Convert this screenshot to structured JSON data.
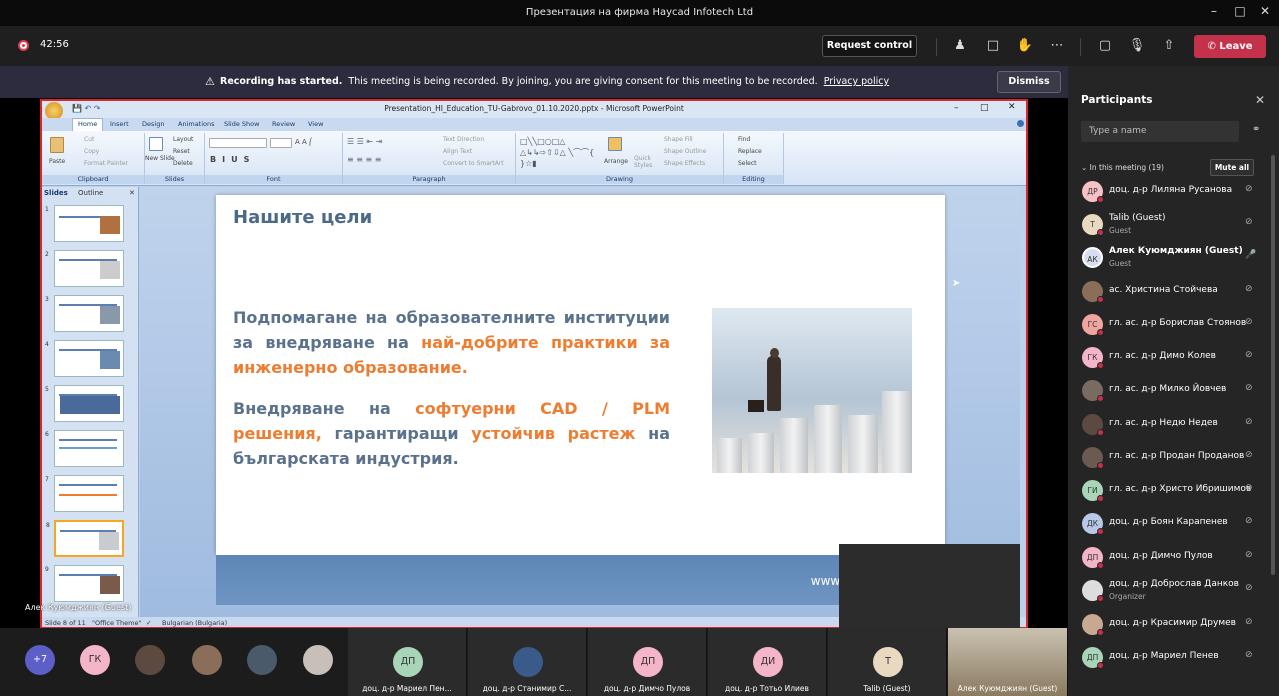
{
  "window": {
    "title": "Презентация на фирма Haycad Infotech Ltd"
  },
  "toolbar": {
    "timer": "42:56",
    "request_control": "Request control",
    "leave": "Leave"
  },
  "banner": {
    "bold": "Recording has started.",
    "text": "This meeting is being recorded. By joining, you are giving consent for this meeting to be recorded.",
    "link": "Privacy policy",
    "dismiss": "Dismiss"
  },
  "ppt": {
    "title": "Presentation_HI_Education_TU-Gabrovo_01.10.2020.pptx - Microsoft PowerPoint",
    "tabs": [
      "Home",
      "Insert",
      "Design",
      "Animations",
      "Slide Show",
      "Review",
      "View"
    ],
    "groups": [
      "Clipboard",
      "Slides",
      "Font",
      "Paragraph",
      "Drawing",
      "Editing"
    ],
    "clipboard": {
      "paste": "Paste",
      "cut": "Cut",
      "copy": "Copy",
      "painter": "Format Painter"
    },
    "slides_grp": {
      "new": "New Slide",
      "layout": "Layout",
      "reset": "Reset",
      "delete": "Delete"
    },
    "paragraph": {
      "dir": "Text Direction",
      "align": "Align Text",
      "smart": "Convert to SmartArt"
    },
    "drawing": {
      "arrange": "Arrange",
      "quick": "Quick Styles",
      "fill": "Shape Fill",
      "outline": "Shape Outline",
      "effects": "Shape Effects"
    },
    "editing": {
      "find": "Find",
      "replace": "Replace",
      "select": "Select"
    },
    "panel_tabs": {
      "slides": "Slides",
      "outline": "Outline"
    },
    "status": {
      "slide": "Slide 8 of 11",
      "theme": "\"Office Theme\"",
      "lang": "Bulgarian (Bulgaria)"
    },
    "slide": {
      "title": "Нашите цели",
      "p1_a": "Подпомагане на образователните институции за внедряване на ",
      "p1_b": "най-добрите практики за инженерно образование.",
      "p2_a": "Внедряване на ",
      "p2_b": "софтуерни CAD / PLM решения,",
      "p2_c": " гарантиращи ",
      "p2_d": "устойчив растеж",
      "p2_e": " на българската индустрия.",
      "footer": "www.hay"
    },
    "presenter_label": "Алек Куюмджиян (Guest)"
  },
  "participants": {
    "header": "Participants",
    "search_placeholder": "Type a name",
    "in_meeting": "In this meeting (19)",
    "mute_all": "Mute all",
    "list": [
      {
        "initials": "ДР",
        "name": "доц. д-р Лиляна Русанова",
        "sub": "",
        "color": "#f7c2c7"
      },
      {
        "initials": "T",
        "name": "Talib (Guest)",
        "sub": "Guest",
        "color": "#e9d9c0"
      },
      {
        "initials": "АК",
        "name": "Алек Куюмджиян (Guest)",
        "sub": "Guest",
        "color": "#d6def0"
      },
      {
        "initials": "",
        "name": "ас. Христина Стойчева",
        "sub": "",
        "color": "#8a6e5a"
      },
      {
        "initials": "ГС",
        "name": "гл. ас. д-р Борислав Стоянов",
        "sub": "",
        "color": "#f0a5a0"
      },
      {
        "initials": "ГК",
        "name": "гл. ас. д-р Димо Колев",
        "sub": "",
        "color": "#f5b5c8"
      },
      {
        "initials": "",
        "name": "гл. ас. д-р Милко Йовчев",
        "sub": "",
        "color": "#7a6b60"
      },
      {
        "initials": "",
        "name": "гл. ас. д-р Недю Недев",
        "sub": "",
        "color": "#5c4a40"
      },
      {
        "initials": "",
        "name": "гл. ас. д-р Продан Проданов",
        "sub": "",
        "color": "#6a5a50"
      },
      {
        "initials": "ГИ",
        "name": "гл. ас. д-р Христо Ибришимов",
        "sub": "",
        "color": "#a8d5b8"
      },
      {
        "initials": "ДК",
        "name": "доц. д-р Боян Карапенев",
        "sub": "",
        "color": "#b8c8e8"
      },
      {
        "initials": "ДП",
        "name": "доц. д-р Димчо Пулов",
        "sub": "",
        "color": "#f5b5c8"
      },
      {
        "initials": "",
        "name": "доц. д-р Доброслав Данков",
        "sub": "Organizer",
        "color": "#dddddd"
      },
      {
        "initials": "",
        "name": "доц. д-р Красимир Друмев",
        "sub": "",
        "color": "#c8a890"
      },
      {
        "initials": "ДП",
        "name": "доц. д-р Мариел Пенев",
        "sub": "",
        "color": "#a8d5b8"
      }
    ]
  },
  "strip": {
    "more": "+7",
    "avatars": [
      {
        "initials": "ГК",
        "color": "#f5b5c8"
      },
      {
        "initials": "",
        "color": "#5c4a40"
      },
      {
        "initials": "",
        "color": "#8a6e5a"
      },
      {
        "initials": "",
        "color": "#4a5a6a"
      },
      {
        "initials": "",
        "color": "#c8c0b8"
      }
    ],
    "tiles": [
      {
        "initials": "ДП",
        "name": "доц. д-р Мариел Пен...",
        "color": "#a8d5b8"
      },
      {
        "initials": "",
        "name": "доц. д-р Станимир С...",
        "color": "#3a5a8a"
      },
      {
        "initials": "ДП",
        "name": "доц. д-р Димчо Пулов",
        "color": "#f5b5c8"
      },
      {
        "initials": "ДИ",
        "name": "доц. д-р Тотьо Илиев",
        "color": "#f5b5c8"
      },
      {
        "initials": "T",
        "name": "Talib (Guest)",
        "color": "#e9d9c0"
      },
      {
        "initials": "",
        "name": "Алек Куюмджиян (Guest)",
        "color": ""
      }
    ]
  }
}
